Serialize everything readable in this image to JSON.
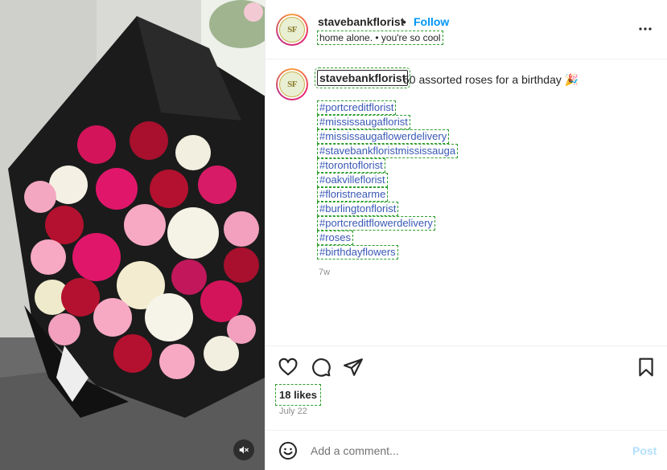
{
  "post_header": {
    "username": "stavebankflorist",
    "separator": "•",
    "follow_label": "Follow",
    "audio": "home alone. • you're so cool",
    "avatar_initials": "SF"
  },
  "caption": {
    "username": "stavebankflorist",
    "text": "50 assorted roses for a birthday 🎉",
    "hashtags": [
      "#portcreditflorist",
      "#mississaugaflorist",
      "#mississaugaflowerdelivery",
      "#stavebankfloristmississauga",
      "#torontoflorist",
      "#oakvilleflorist",
      "#floristnearme",
      "#burlingtonflorist",
      "#portcreditflowerdelivery",
      "#roses",
      "#birthdayflowers"
    ],
    "time_ago": "7w"
  },
  "engagement": {
    "likes": "18 likes",
    "date": "July 22"
  },
  "comment_box": {
    "placeholder": "Add a comment...",
    "post_label": "Post"
  },
  "icons": {
    "more": "more-options-icon",
    "like": "heart-icon",
    "comment": "comment-icon",
    "share": "share-icon",
    "save": "bookmark-icon",
    "emoji": "emoji-icon",
    "mute": "muted-speaker-icon"
  },
  "colors": {
    "link_blue": "#0095f6",
    "hashtag_blue": "#3a58b5",
    "post_disabled": "#b2dffc",
    "muted_text": "#8e8e8e"
  }
}
